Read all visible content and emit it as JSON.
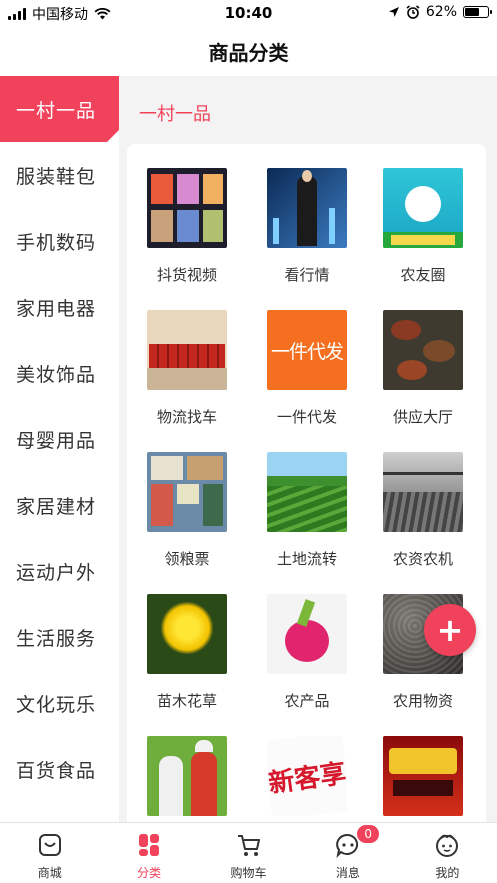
{
  "status_bar": {
    "carrier": "中国移动",
    "time": "10:40",
    "battery": "62%",
    "battery_level": 0.62
  },
  "header": {
    "title": "商品分类"
  },
  "sidebar": {
    "items": [
      {
        "label": "一村一品",
        "active": true
      },
      {
        "label": "服装鞋包"
      },
      {
        "label": "手机数码"
      },
      {
        "label": "家用电器"
      },
      {
        "label": "美妆饰品"
      },
      {
        "label": "母婴用品"
      },
      {
        "label": "家居建材"
      },
      {
        "label": "运动户外"
      },
      {
        "label": "生活服务"
      },
      {
        "label": "文化玩乐"
      },
      {
        "label": "百货食品"
      }
    ]
  },
  "content": {
    "category_title": "一村一品",
    "tiles": [
      {
        "label": "抖货视频",
        "icon": "video-thumbnail"
      },
      {
        "label": "看行情",
        "icon": "market-thumbnail"
      },
      {
        "label": "农友圈",
        "icon": "community-thumbnail"
      },
      {
        "label": "物流找车",
        "icon": "trucks-thumbnail"
      },
      {
        "label": "一件代发",
        "thumb_text": "一件代发",
        "icon": "dropship-thumbnail"
      },
      {
        "label": "供应大厅",
        "icon": "crayfish-thumbnail"
      },
      {
        "label": "领粮票",
        "icon": "stamps-thumbnail"
      },
      {
        "label": "土地流转",
        "icon": "tea-field-thumbnail"
      },
      {
        "label": "农资农机",
        "icon": "irrigation-thumbnail"
      },
      {
        "label": "苗木花草",
        "icon": "chrysanthemum-thumbnail"
      },
      {
        "label": "农产品",
        "icon": "dragonfruit-thumbnail"
      },
      {
        "label": "农用物资",
        "icon": "seeds-thumbnail"
      },
      {
        "label": "",
        "icon": "workers-thumbnail"
      },
      {
        "label": "",
        "thumb_text": "新客享",
        "icon": "new-customer-thumbnail"
      },
      {
        "label": "",
        "icon": "promo-thumbnail"
      }
    ]
  },
  "fab": {
    "label": "+"
  },
  "tabbar": {
    "items": [
      {
        "label": "商城",
        "icon": "mall-icon"
      },
      {
        "label": "分类",
        "icon": "category-icon",
        "active": true
      },
      {
        "label": "购物车",
        "icon": "cart-icon"
      },
      {
        "label": "消息",
        "icon": "message-icon",
        "badge": "0"
      },
      {
        "label": "我的",
        "icon": "profile-icon"
      }
    ]
  },
  "colors": {
    "accent": "#f0425a"
  }
}
